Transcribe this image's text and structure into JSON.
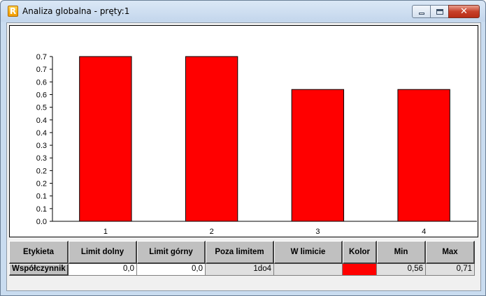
{
  "window": {
    "icon": "R",
    "title": "Analiza globalna - pręty:1",
    "controls": {
      "minimize_icon": "minimize-icon",
      "maximize_icon": "maximize-icon",
      "close_icon": "close-icon",
      "close_glyph": "✕"
    }
  },
  "chart_data": {
    "type": "bar",
    "categories": [
      "1",
      "2",
      "3",
      "4"
    ],
    "values": [
      0.71,
      0.71,
      0.56,
      0.56
    ],
    "ylim": [
      0.0,
      0.7
    ],
    "yticks": [
      "0.0",
      "0.1",
      "0.1",
      "0.2",
      "0.2",
      "0.3",
      "0.3",
      "0.4",
      "0.4",
      "0.5",
      "0.6",
      "0.6",
      "0.7",
      "0.7"
    ],
    "bar_color": "#ff0000",
    "grid": false,
    "title": "",
    "xlabel": "",
    "ylabel": ""
  },
  "table": {
    "headers": [
      "Etykieta",
      "Limit dolny",
      "Limit górny",
      "Poza limitem",
      "W limicie",
      "Kolor",
      "Min",
      "Max"
    ],
    "row": {
      "label": "Współczynnik",
      "limit_dolny": "0,0",
      "limit_gorny": "0,0",
      "poza_limitem": "1do4",
      "w_limicie": "",
      "kolor": "#ff0000",
      "min": "0,56",
      "max": "0,71"
    }
  }
}
